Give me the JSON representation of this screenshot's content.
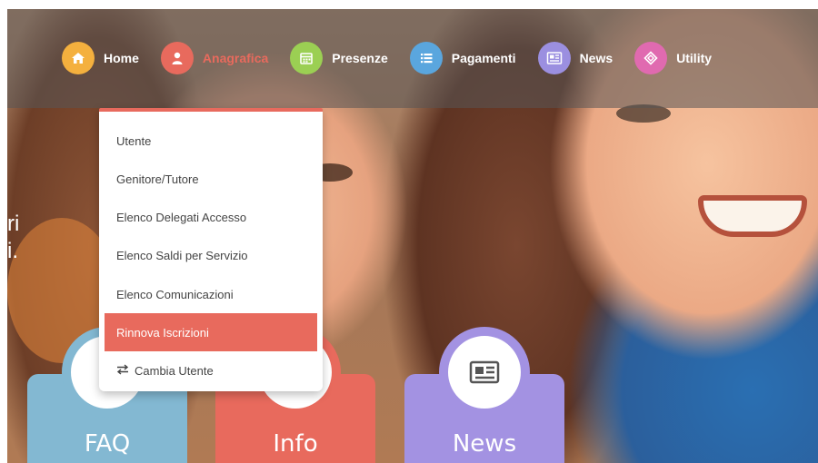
{
  "nav": {
    "items": [
      {
        "label": "Home",
        "icon": "home-icon",
        "color": "#f4b03e"
      },
      {
        "label": "Anagrafica",
        "icon": "user-icon",
        "color": "#e86a5d",
        "active": true
      },
      {
        "label": "Presenze",
        "icon": "calendar-icon",
        "color": "#9bcf53"
      },
      {
        "label": "Pagamenti",
        "icon": "list-icon",
        "color": "#5aa6de"
      },
      {
        "label": "News",
        "icon": "newspaper-icon",
        "color": "#9b8fe0"
      },
      {
        "label": "Utility",
        "icon": "diamond-icon",
        "color": "#e06ab0"
      }
    ]
  },
  "dropdown": {
    "items": [
      {
        "label": "Utente"
      },
      {
        "label": "Genitore/Tutore"
      },
      {
        "label": "Elenco Delegati Accesso"
      },
      {
        "label": "Elenco Saldi per Servizio"
      },
      {
        "label": "Elenco Comunicazioni"
      },
      {
        "label": "Rinnova Iscrizioni",
        "active": true
      },
      {
        "label": "Cambia Utente",
        "icon": "swap-icon"
      }
    ]
  },
  "hero": {
    "text_line1": "ri",
    "text_line2": "i."
  },
  "cards": [
    {
      "label": "FAQ",
      "color": "#83b8d2"
    },
    {
      "label": "Info",
      "color": "#e86a5d"
    },
    {
      "label": "News",
      "color": "#a392e2",
      "icon": "newspaper-icon"
    }
  ]
}
